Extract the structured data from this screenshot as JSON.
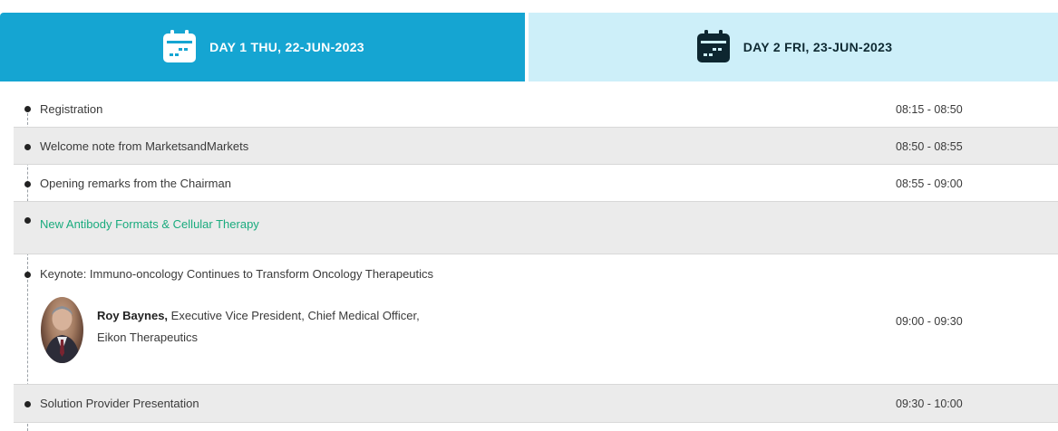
{
  "tabs": [
    {
      "label": "DAY 1 THU, 22-JUN-2023",
      "icon": "calendar-icon",
      "active": true
    },
    {
      "label": "DAY 2 FRI, 23-JUN-2023",
      "icon": "calendar-icon",
      "active": false
    }
  ],
  "colors": {
    "active_tab": "#15a5d2",
    "inactive_tab": "#cdeff9",
    "session_title": "#1aab7e"
  },
  "agenda": [
    {
      "title": "Registration",
      "time": "08:15 - 08:50"
    },
    {
      "title": "Welcome note from MarketsandMarkets",
      "time": "08:50 - 08:55"
    },
    {
      "title": "Opening remarks from the Chairman",
      "time": "08:55 - 09:00"
    },
    {
      "title": "New Antibody Formats & Cellular Therapy",
      "time": ""
    },
    {
      "title": "Keynote: Immuno-oncology Continues to Transform Oncology Therapeutics",
      "time": "09:00 - 09:30",
      "speaker": {
        "name": "Roy Baynes,",
        "role": "Executive Vice President, Chief Medical Officer, Eikon Therapeutics"
      }
    },
    {
      "title": "Solution Provider Presentation",
      "time": "09:30 - 10:00"
    }
  ]
}
